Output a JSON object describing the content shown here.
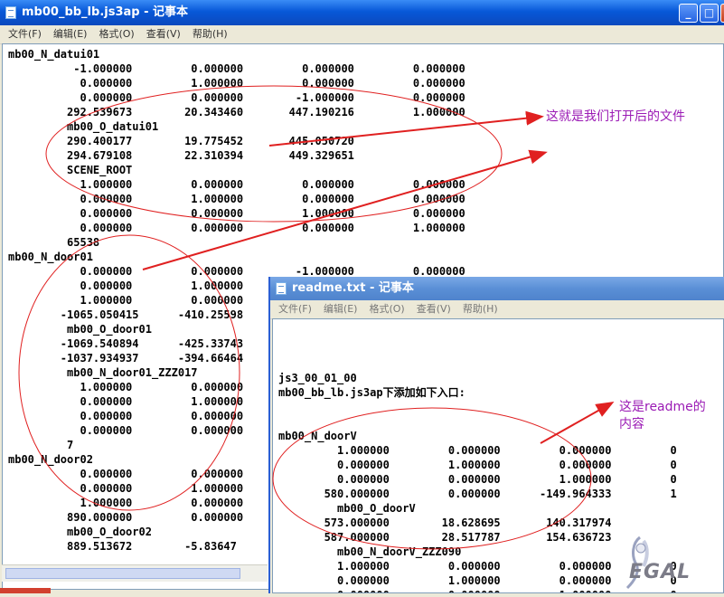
{
  "win1": {
    "title": "mb00_bb_lb.js3ap - 记事本",
    "menu": [
      "文件(F)",
      "编辑(E)",
      "格式(O)",
      "查看(V)",
      "帮助(H)"
    ],
    "lines": [
      "mb00_N_datui01",
      "          -1.000000         0.000000         0.000000         0.000000",
      "           0.000000         1.000000         0.000000         0.000000",
      "           0.000000         0.000000        -1.000000         0.000000",
      "         292.539673        20.343460       447.190216         1.000000",
      "         mb00_O_datui01",
      "         290.400177        19.775452       445.050720",
      "         294.679108        22.310394       449.329651",
      "         SCENE_ROOT",
      "           1.000000         0.000000         0.000000         0.000000",
      "           0.000000         1.000000         0.000000         0.000000",
      "           0.000000         0.000000         1.000000         0.000000",
      "           0.000000         0.000000         0.000000         1.000000",
      "         65538",
      "mb00_N_door01",
      "           0.000000         0.000000        -1.000000         0.000000",
      "           0.000000         1.000000",
      "           1.000000         0.000000",
      "        -1065.050415      -410.25598",
      "         mb00_O_door01",
      "        -1069.540894      -425.33743",
      "        -1037.934937      -394.66464",
      "         mb00_N_door01_ZZZ017",
      "           1.000000         0.000000",
      "           0.000000         1.000000",
      "           0.000000         0.000000",
      "           0.000000         0.000000",
      "         7",
      "mb00_N_door02",
      "           0.000000         0.000000",
      "           0.000000         1.000000",
      "           1.000000         0.000000",
      "         890.000000         0.000000",
      "         mb00_O_door02",
      "         889.513672        -5.83647"
    ]
  },
  "win2": {
    "title": "readme.txt - 记事本",
    "menu": [
      "文件(F)",
      "编辑(E)",
      "格式(O)",
      "查看(V)",
      "帮助(H)"
    ],
    "lines": [
      "",
      "",
      "",
      "js3_00_01_00",
      "mb00_bb_lb.js3ap下添加如下入口:",
      "",
      "",
      "mb00_N_doorV",
      "         1.000000         0.000000         0.000000         0",
      "         0.000000         1.000000         0.000000         0",
      "         0.000000         0.000000         1.000000         0",
      "       580.000000         0.000000      -149.964333         1",
      "         mb00_O_doorV",
      "       573.000000        18.628695       140.317974",
      "       587.000000        28.517787       154.636723",
      "         mb00_N_doorV_ZZZ090",
      "         1.000000         0.000000         0.000000         0",
      "         0.000000         1.000000         0.000000         0",
      "         0.000000         0.000000         1.000000         0"
    ]
  },
  "annotations": {
    "file_note": "这就是我们打开后的文件",
    "readme_note_line1": "这是readme的",
    "readme_note_line2": "内容"
  },
  "watermark_text": "EGAL",
  "colors": {
    "annotation_ink": "#e02020",
    "annotation_text": "#9b1bb5",
    "xp_title_blue": "#0a4ec7"
  }
}
